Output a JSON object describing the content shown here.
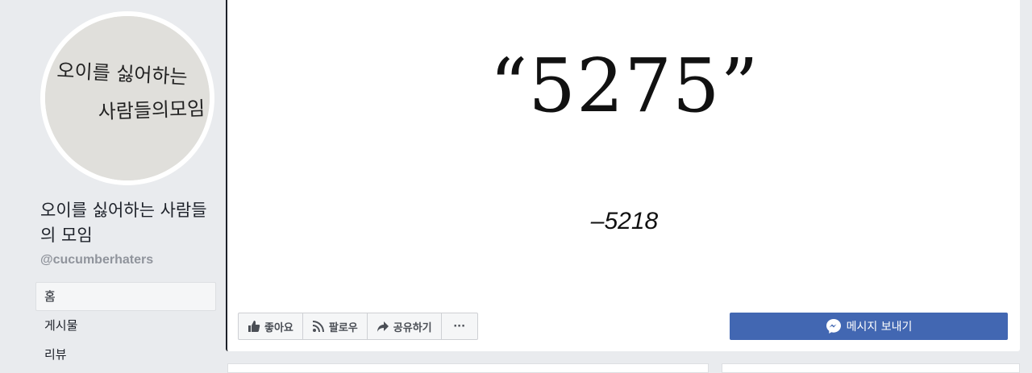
{
  "page": {
    "name": "오이를 싫어하는 사람들의 모임",
    "handle": "@cucumberhaters",
    "avatar_text_line1": "오이를 싫어하는",
    "avatar_text_line2": "사람들의모임"
  },
  "nav": {
    "items": [
      {
        "label": "홈",
        "active": true
      },
      {
        "label": "게시물"
      },
      {
        "label": "리뷰"
      }
    ]
  },
  "cover": {
    "quote": "“5275”",
    "attribution": "–5218"
  },
  "actions": {
    "like": "좋아요",
    "follow": "팔로우",
    "share": "공유하기",
    "more": "···"
  },
  "message_button": {
    "label": "메시지 보내기",
    "color": "#4267b2"
  },
  "icons": [
    "like-thumb-icon",
    "rss-follow-icon",
    "share-arrow-icon",
    "messenger-icon"
  ]
}
